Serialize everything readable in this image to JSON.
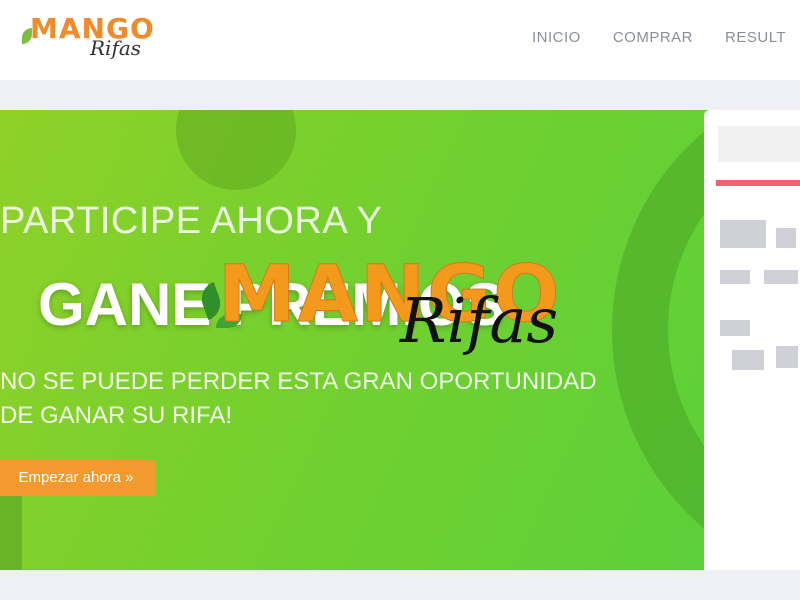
{
  "header": {
    "logo_word": "MANGO",
    "logo_sub": "Rifas",
    "nav": [
      {
        "label": "INICIO"
      },
      {
        "label": "COMPRAR"
      },
      {
        "label": "RESULT"
      }
    ]
  },
  "hero": {
    "line1": "PARTICIPE AHORA Y",
    "title": "GANE PREMIOS",
    "sub1": "NO SE PUEDE PERDER ESTA GRAN OPORTUNIDAD",
    "sub2": "DE GANAR SU RIFA!",
    "cta_label": "Empezar ahora »"
  },
  "overlay_logo": {
    "word": "MANGO",
    "sub": "Rifas"
  },
  "icons": {
    "leaf": "leaf-icon"
  },
  "colors": {
    "brand_orange": "#f39a1c",
    "hero_green": "#72d02f",
    "cta_orange": "#f29a2e"
  }
}
